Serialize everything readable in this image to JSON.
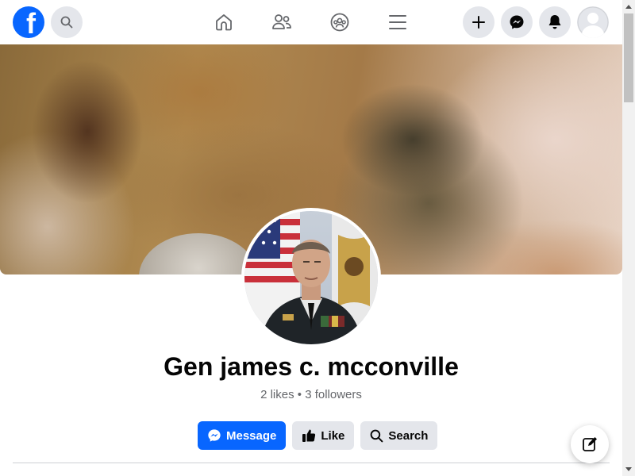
{
  "topbar": {
    "logo_letter": "f",
    "icons": {
      "logo": "facebook-logo-icon",
      "search": "search-icon",
      "home": "home-icon",
      "friends": "friends-icon",
      "groups": "groups-icon",
      "menu": "hamburger-menu-icon",
      "create": "plus-icon",
      "messenger": "messenger-icon",
      "notifications": "bell-icon",
      "account": "avatar-icon"
    }
  },
  "profile": {
    "name": "Gen james c. mcconville",
    "stats": "2 likes • 3 followers"
  },
  "actions": {
    "message_label": "Message",
    "like_label": "Like",
    "search_label": "Search"
  },
  "colors": {
    "brand": "#0866ff",
    "secondary_button": "#e4e6eb",
    "text_primary": "#050505",
    "text_secondary": "#65676b"
  }
}
